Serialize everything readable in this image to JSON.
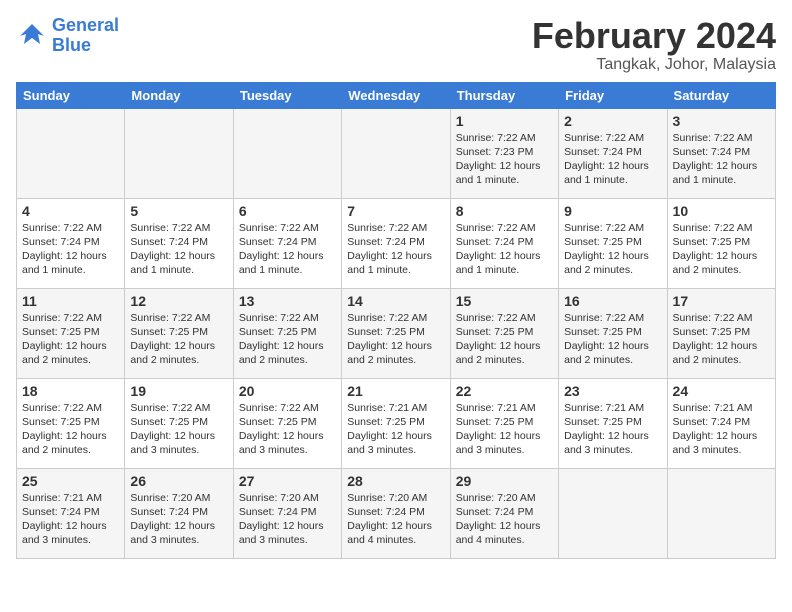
{
  "logo": {
    "line1": "General",
    "line2": "Blue"
  },
  "title": "February 2024",
  "subtitle": "Tangkak, Johor, Malaysia",
  "weekdays": [
    "Sunday",
    "Monday",
    "Tuesday",
    "Wednesday",
    "Thursday",
    "Friday",
    "Saturday"
  ],
  "weeks": [
    [
      {
        "day": "",
        "info": ""
      },
      {
        "day": "",
        "info": ""
      },
      {
        "day": "",
        "info": ""
      },
      {
        "day": "",
        "info": ""
      },
      {
        "day": "1",
        "info": "Sunrise: 7:22 AM\nSunset: 7:23 PM\nDaylight: 12 hours\nand 1 minute."
      },
      {
        "day": "2",
        "info": "Sunrise: 7:22 AM\nSunset: 7:24 PM\nDaylight: 12 hours\nand 1 minute."
      },
      {
        "day": "3",
        "info": "Sunrise: 7:22 AM\nSunset: 7:24 PM\nDaylight: 12 hours\nand 1 minute."
      }
    ],
    [
      {
        "day": "4",
        "info": "Sunrise: 7:22 AM\nSunset: 7:24 PM\nDaylight: 12 hours\nand 1 minute."
      },
      {
        "day": "5",
        "info": "Sunrise: 7:22 AM\nSunset: 7:24 PM\nDaylight: 12 hours\nand 1 minute."
      },
      {
        "day": "6",
        "info": "Sunrise: 7:22 AM\nSunset: 7:24 PM\nDaylight: 12 hours\nand 1 minute."
      },
      {
        "day": "7",
        "info": "Sunrise: 7:22 AM\nSunset: 7:24 PM\nDaylight: 12 hours\nand 1 minute."
      },
      {
        "day": "8",
        "info": "Sunrise: 7:22 AM\nSunset: 7:24 PM\nDaylight: 12 hours\nand 1 minute."
      },
      {
        "day": "9",
        "info": "Sunrise: 7:22 AM\nSunset: 7:25 PM\nDaylight: 12 hours\nand 2 minutes."
      },
      {
        "day": "10",
        "info": "Sunrise: 7:22 AM\nSunset: 7:25 PM\nDaylight: 12 hours\nand 2 minutes."
      }
    ],
    [
      {
        "day": "11",
        "info": "Sunrise: 7:22 AM\nSunset: 7:25 PM\nDaylight: 12 hours\nand 2 minutes."
      },
      {
        "day": "12",
        "info": "Sunrise: 7:22 AM\nSunset: 7:25 PM\nDaylight: 12 hours\nand 2 minutes."
      },
      {
        "day": "13",
        "info": "Sunrise: 7:22 AM\nSunset: 7:25 PM\nDaylight: 12 hours\nand 2 minutes."
      },
      {
        "day": "14",
        "info": "Sunrise: 7:22 AM\nSunset: 7:25 PM\nDaylight: 12 hours\nand 2 minutes."
      },
      {
        "day": "15",
        "info": "Sunrise: 7:22 AM\nSunset: 7:25 PM\nDaylight: 12 hours\nand 2 minutes."
      },
      {
        "day": "16",
        "info": "Sunrise: 7:22 AM\nSunset: 7:25 PM\nDaylight: 12 hours\nand 2 minutes."
      },
      {
        "day": "17",
        "info": "Sunrise: 7:22 AM\nSunset: 7:25 PM\nDaylight: 12 hours\nand 2 minutes."
      }
    ],
    [
      {
        "day": "18",
        "info": "Sunrise: 7:22 AM\nSunset: 7:25 PM\nDaylight: 12 hours\nand 2 minutes."
      },
      {
        "day": "19",
        "info": "Sunrise: 7:22 AM\nSunset: 7:25 PM\nDaylight: 12 hours\nand 3 minutes."
      },
      {
        "day": "20",
        "info": "Sunrise: 7:22 AM\nSunset: 7:25 PM\nDaylight: 12 hours\nand 3 minutes."
      },
      {
        "day": "21",
        "info": "Sunrise: 7:21 AM\nSunset: 7:25 PM\nDaylight: 12 hours\nand 3 minutes."
      },
      {
        "day": "22",
        "info": "Sunrise: 7:21 AM\nSunset: 7:25 PM\nDaylight: 12 hours\nand 3 minutes."
      },
      {
        "day": "23",
        "info": "Sunrise: 7:21 AM\nSunset: 7:25 PM\nDaylight: 12 hours\nand 3 minutes."
      },
      {
        "day": "24",
        "info": "Sunrise: 7:21 AM\nSunset: 7:24 PM\nDaylight: 12 hours\nand 3 minutes."
      }
    ],
    [
      {
        "day": "25",
        "info": "Sunrise: 7:21 AM\nSunset: 7:24 PM\nDaylight: 12 hours\nand 3 minutes."
      },
      {
        "day": "26",
        "info": "Sunrise: 7:20 AM\nSunset: 7:24 PM\nDaylight: 12 hours\nand 3 minutes."
      },
      {
        "day": "27",
        "info": "Sunrise: 7:20 AM\nSunset: 7:24 PM\nDaylight: 12 hours\nand 3 minutes."
      },
      {
        "day": "28",
        "info": "Sunrise: 7:20 AM\nSunset: 7:24 PM\nDaylight: 12 hours\nand 4 minutes."
      },
      {
        "day": "29",
        "info": "Sunrise: 7:20 AM\nSunset: 7:24 PM\nDaylight: 12 hours\nand 4 minutes."
      },
      {
        "day": "",
        "info": ""
      },
      {
        "day": "",
        "info": ""
      }
    ]
  ]
}
